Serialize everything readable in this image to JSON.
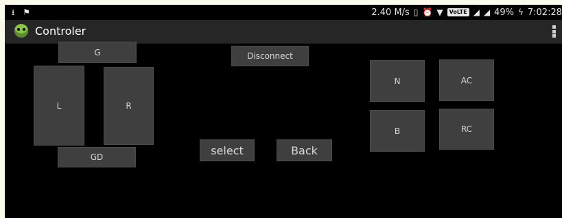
{
  "status_bar": {
    "speed": "2.40 M/s",
    "battery": "49%",
    "time": "7:02:28",
    "volte": "VoLTE"
  },
  "action_bar": {
    "title": "Controler"
  },
  "controls": {
    "g": "G",
    "l": "L",
    "r": "R",
    "gd": "GD",
    "disconnect": "Disconnect",
    "select": "select",
    "back": "Back",
    "n": "N",
    "ac": "AC",
    "b": "B",
    "rc": "RC"
  }
}
